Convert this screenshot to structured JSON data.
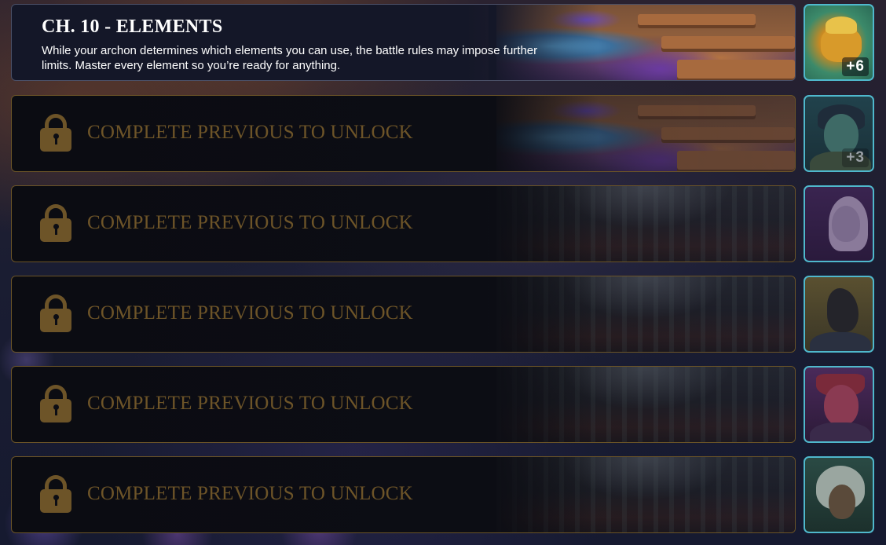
{
  "chapters": [
    {
      "status": "unlocked",
      "title": "CH. 10 - ELEMENTS",
      "description": "While your archon determines which elements you can use, the battle rules may impose further limits. Master every element so you’re ready for anything.",
      "reward": {
        "count": "+6",
        "icon": "golden-armored-creature-card"
      }
    },
    {
      "status": "locked",
      "lock_text": "COMPLETE PREVIOUS TO UNLOCK",
      "reward": {
        "count": "+3",
        "icon": "rogue-character-card"
      }
    },
    {
      "status": "locked",
      "lock_text": "COMPLETE PREVIOUS TO UNLOCK",
      "reward": {
        "icon": "elf-mage-card"
      }
    },
    {
      "status": "locked",
      "lock_text": "COMPLETE PREVIOUS TO UNLOCK",
      "reward": {
        "icon": "werewolf-card"
      }
    },
    {
      "status": "locked",
      "lock_text": "COMPLETE PREVIOUS TO UNLOCK",
      "reward": {
        "icon": "demon-cat-card"
      }
    },
    {
      "status": "locked",
      "lock_text": "COMPLETE PREVIOUS TO UNLOCK",
      "reward": {
        "icon": "white-wolf-warrior-card"
      }
    }
  ],
  "colors": {
    "locked_gold": "#6d5428",
    "locked_border": "#6b5427",
    "reward_border": "#4fb8cc",
    "title_text": "#ffffff"
  }
}
